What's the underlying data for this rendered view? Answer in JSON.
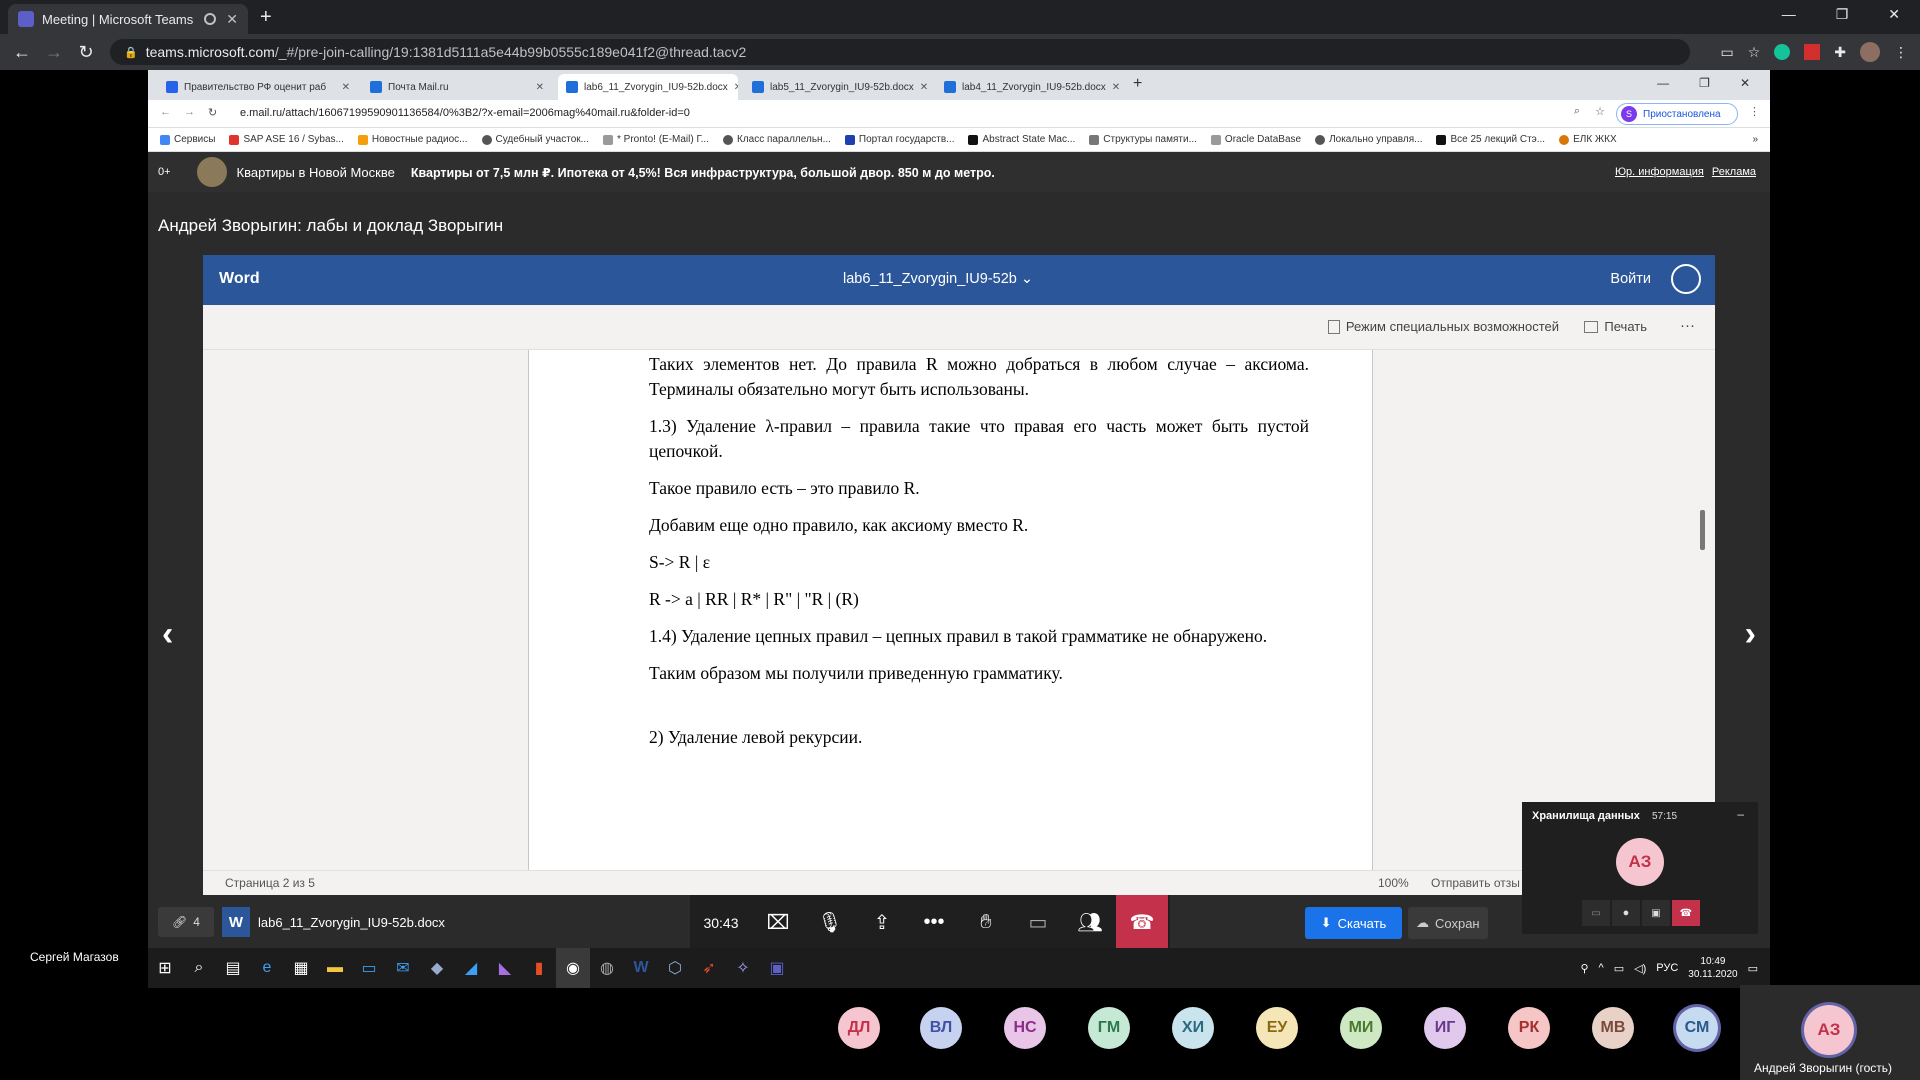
{
  "outer_browser": {
    "tab_title": "Meeting | Microsoft Teams",
    "url_host": "teams.microsoft.com",
    "url_path": "/_#/pre-join-calling/19:1381d5111a5e44b99b0555c189e041f2@thread.tacv2"
  },
  "inner_browser": {
    "tabs": [
      {
        "label": "Правительство РФ оценит раб",
        "color": "#2563eb"
      },
      {
        "label": "Почта Mail.ru",
        "color": "#1e6fd9"
      },
      {
        "label": "lab6_11_Zvorygin_IU9-52b.docx",
        "color": "#1e6fd9"
      },
      {
        "label": "lab5_11_Zvorygin_IU9-52b.docx",
        "color": "#1e6fd9"
      },
      {
        "label": "lab4_11_Zvorygin_IU9-52b.docx",
        "color": "#1e6fd9"
      }
    ],
    "url": "e.mail.ru/attach/16067199590901136584/0%3B2/?x-email=2006mag%40mail.ru&folder-id=0",
    "paused_label": "Приостановлена",
    "paused_avatar": "S",
    "bookmarks": [
      {
        "label": "Сервисы",
        "color": "#4285f4"
      },
      {
        "label": "SAP ASE 16 / Sybas...",
        "color": "#e0342d"
      },
      {
        "label": "Новостные радиос...",
        "color": "#f59e0b"
      },
      {
        "label": "Судебный участок...",
        "color": "#555555"
      },
      {
        "label": "* Pronto! (E-Mail) Г...",
        "color": "#999999"
      },
      {
        "label": "Класс параллельн...",
        "color": "#555555"
      },
      {
        "label": "Портал государств...",
        "color": "#1e40af"
      },
      {
        "label": "Abstract State Mac...",
        "color": "#111111"
      },
      {
        "label": "Структуры памяти...",
        "color": "#777777"
      },
      {
        "label": "Oracle DataBase",
        "color": "#999999"
      },
      {
        "label": "Локально управля...",
        "color": "#555555"
      },
      {
        "label": "Все 25 лекций Стэ...",
        "color": "#111111"
      },
      {
        "label": "ЕЛК ЖКХ",
        "color": "#d97706"
      }
    ],
    "more_bookmarks": "»"
  },
  "ad": {
    "age": "0+",
    "title": "Квартиры в Новой Москве",
    "text": "Квартиры от 7,5 млн ₽. Ипотека от 4,5%! Вся инфраструктура, большой двор. 850 м до метро.",
    "legal": "Юр. информация",
    "ad_label": "Реклама"
  },
  "mail_subject": "Андрей Зворыгин: лабы и доклад Зворыгин",
  "word": {
    "app": "Word",
    "doc_title": "lab6_11_Zvorygin_IU9-52b",
    "sign_in": "Войти",
    "accessibility": "Режим специальных возможностей",
    "print": "Печать",
    "more": "···",
    "paragraphs": [
      "Таких элементов нет. До правила R можно добраться в любом случае – аксиома. Терминалы обязательно могут быть использованы.",
      "1.3) Удаление λ-правил – правила такие что правая его часть может быть пустой цепочкой.",
      "Такое правило есть – это правило R.",
      "Добавим еще одно правило, как аксиому вместо R.",
      "S-> R | ε",
      "R -> a | RR | R* | R\" | \"R | (R)",
      "1.4) Удаление цепных правил – цепных правил в такой грамматике не обнаружено.",
      "Таким образом мы получили приведенную грамматику.",
      "2) Удаление левой рекурсии."
    ],
    "page_status": "Страница 2 из 5",
    "zoom": "100%",
    "feedback": "Отправить отзы"
  },
  "attachment": {
    "count": "4",
    "filename": "lab6_11_Zvorygin_IU9-52b.docx",
    "download": "Скачать",
    "save": "Сохран"
  },
  "meeting": {
    "timer": "30:43",
    "presenter": "Сергей Магазов"
  },
  "mini_video": {
    "title": "Хранилища данных",
    "timer": "57:15",
    "initials": "АЗ",
    "minimize": "–"
  },
  "taskbar": {
    "lang": "РУС",
    "time": "10:49",
    "date": "30.11.2020"
  },
  "participants": [
    {
      "initials": "ДЛ",
      "color": "#f6c6d0"
    },
    {
      "initials": "ВЛ",
      "color": "#c7d2f0"
    },
    {
      "initials": "НС",
      "color": "#e9c6e8"
    },
    {
      "initials": "ГМ",
      "color": "#c6e9d6"
    },
    {
      "initials": "ХИ",
      "color": "#c9e4ec"
    },
    {
      "initials": "ЕУ",
      "color": "#f5e6b8"
    },
    {
      "initials": "МИ",
      "color": "#cfe8c4"
    },
    {
      "initials": "ИГ",
      "color": "#e0c9ec"
    },
    {
      "initials": "РК",
      "color": "#f6c6c6"
    },
    {
      "initials": "МВ",
      "color": "#e8d2c8"
    },
    {
      "initials": "СМ",
      "color": "#c6daf0"
    }
  ],
  "self": {
    "initials": "АЗ",
    "name": "Андрей Зворыгин (гость)"
  }
}
